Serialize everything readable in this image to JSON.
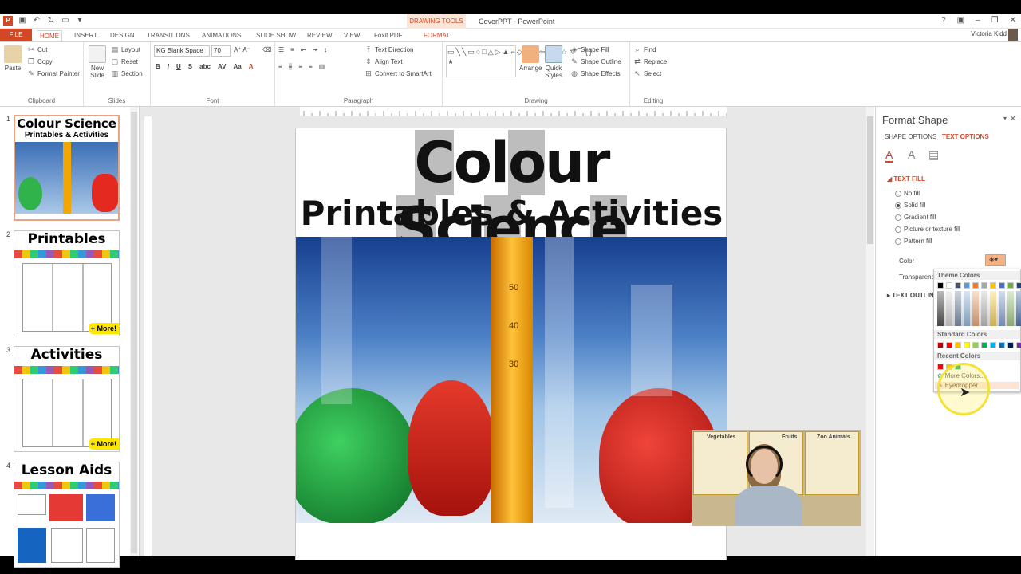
{
  "window": {
    "title": "CoverPPT - PowerPoint",
    "contextual_tab_group": "DRAWING TOOLS",
    "user_name": "Victoria Kidd"
  },
  "ribbon_tabs": [
    "FILE",
    "HOME",
    "INSERT",
    "DESIGN",
    "TRANSITIONS",
    "ANIMATIONS",
    "SLIDE SHOW",
    "REVIEW",
    "VIEW",
    "Foxit PDF",
    "FORMAT"
  ],
  "ribbon": {
    "clipboard": {
      "paste": "Paste",
      "cut": "Cut",
      "copy": "Copy",
      "format_painter": "Format Painter",
      "label": "Clipboard"
    },
    "slides": {
      "new_slide": "New\nSlide",
      "layout": "Layout",
      "reset": "Reset",
      "section": "Section",
      "label": "Slides"
    },
    "font": {
      "name": "KG Blank Space",
      "size": "70",
      "label": "Font"
    },
    "paragraph": {
      "text_direction": "Text Direction",
      "align_text": "Align Text",
      "convert": "Convert to SmartArt",
      "label": "Paragraph"
    },
    "drawing": {
      "arrange": "Arrange",
      "quick_styles": "Quick\nStyles",
      "shape_fill": "Shape Fill",
      "shape_outline": "Shape Outline",
      "shape_effects": "Shape Effects",
      "label": "Drawing"
    },
    "editing": {
      "find": "Find",
      "replace": "Replace",
      "select": "Select",
      "label": "Editing"
    }
  },
  "thumbnails": [
    {
      "num": "1",
      "title": "Colour Science",
      "subtitle": "Printables & Activities"
    },
    {
      "num": "2",
      "title": "Printables",
      "more": "+ More!"
    },
    {
      "num": "3",
      "title": "Activities",
      "more": "+ More!"
    },
    {
      "num": "4",
      "title": "Lesson Aids"
    }
  ],
  "slide": {
    "title_parts": [
      "C",
      "o",
      "l",
      "o",
      "ur ",
      "S",
      "ci",
      "e",
      "nc",
      "e"
    ],
    "subtitle": "Printables & Activities",
    "cylinder_marks": [
      "50",
      "40",
      "30"
    ]
  },
  "ruler_h": [
    "16",
    "15",
    "14",
    "13",
    "12",
    "11",
    "10",
    "9",
    "8",
    "7",
    "6",
    "5",
    "4",
    "3",
    "2",
    "1",
    "0",
    "1",
    "2",
    "3",
    "4",
    "5",
    "6",
    "7",
    "8",
    "9",
    "10",
    "11",
    "12",
    "13",
    "14",
    "15",
    "16",
    "17",
    "18",
    "19",
    "20"
  ],
  "pane": {
    "title": "Format Shape",
    "tabs": [
      "SHAPE OPTIONS",
      "TEXT OPTIONS"
    ],
    "text_fill": "TEXT FILL",
    "fill_options": [
      "No fill",
      "Solid fill",
      "Gradient fill",
      "Picture or texture fill",
      "Pattern fill"
    ],
    "color_label": "Color",
    "transparency_label": "Transparenc",
    "text_outline": "TEXT OUTLIN"
  },
  "palette": {
    "theme_colors": "Theme Colors",
    "standard_colors": "Standard Colors",
    "recent_colors": "Recent Colors",
    "more_colors": "More Colors...",
    "eyedropper": "Eyedropper",
    "theme_row": [
      "#000000",
      "#ffffff",
      "#44546a",
      "#5b9bd5",
      "#ed7d31",
      "#a5a5a5",
      "#ffc000",
      "#4472c4",
      "#70ad47",
      "#264478"
    ],
    "standard_row": [
      "#c00000",
      "#ff0000",
      "#ffc000",
      "#ffff00",
      "#92d050",
      "#00b050",
      "#00b0f0",
      "#0070c0",
      "#002060",
      "#7030a0"
    ],
    "recent_row": [
      "#ff0000",
      "#ffc000",
      "#00b050"
    ]
  },
  "webcam": {
    "posters": [
      "Vegetables",
      "Fruits",
      "Zoo Animals"
    ]
  }
}
